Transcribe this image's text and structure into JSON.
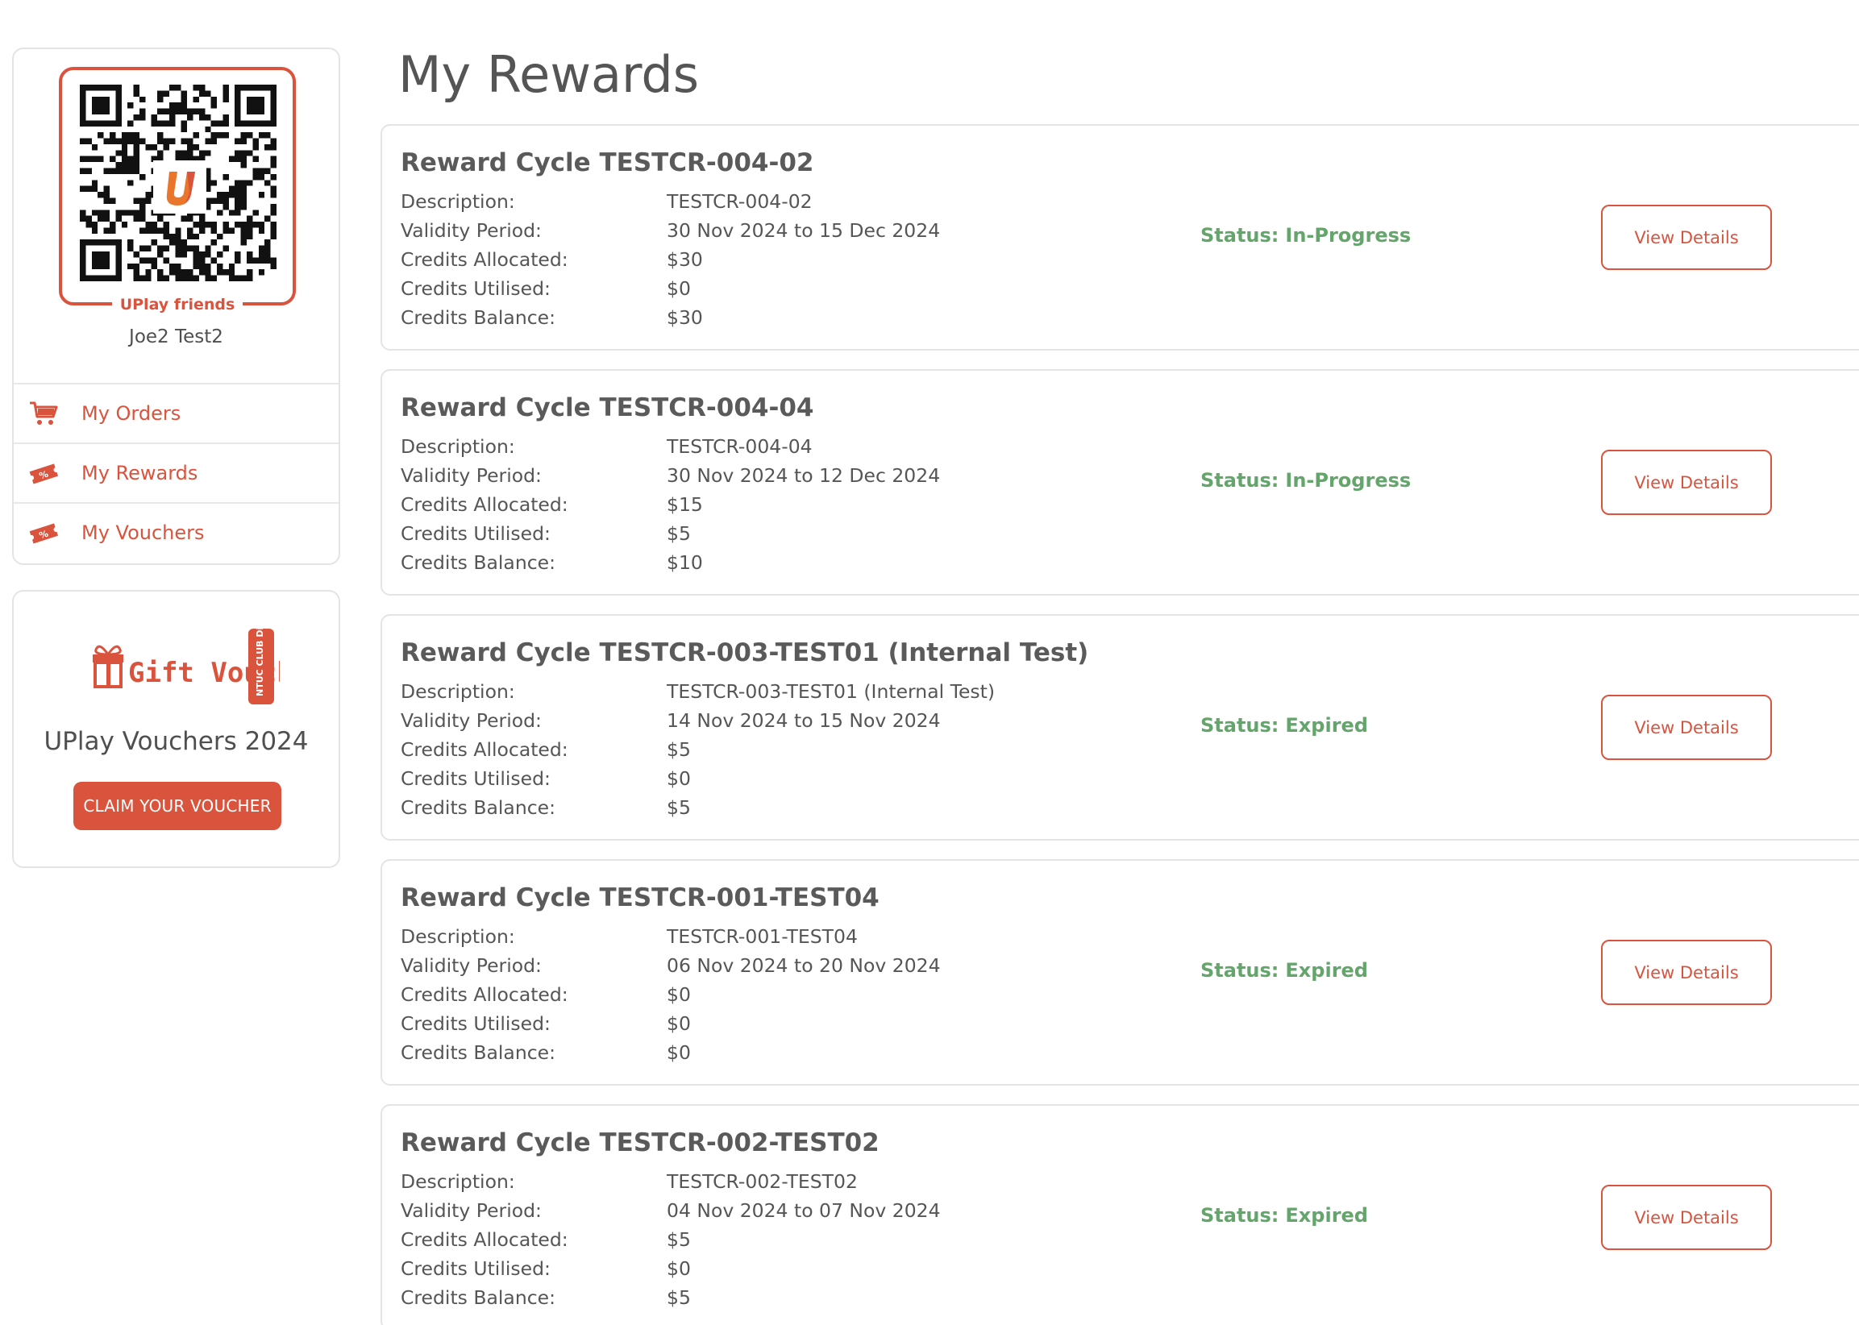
{
  "sidebar": {
    "qr_caption": "UPlay friends",
    "profile_name": "Joe2 Test2",
    "menu": [
      {
        "label": "My Orders",
        "icon": "shopping-cart-icon"
      },
      {
        "label": "My Rewards",
        "icon": "ticket-icon"
      },
      {
        "label": "My Vouchers",
        "icon": "ticket-icon"
      }
    ],
    "voucher": {
      "logo_text": "Gift Voucher",
      "logo_badge": "NTUC CLUB Discount",
      "title": "UPlay Vouchers 2024",
      "claim_label": "CLAIM YOUR VOUCHER"
    }
  },
  "main": {
    "title": "My Rewards",
    "field_labels": {
      "description": "Description:",
      "validity": "Validity Period:",
      "allocated": "Credits Allocated:",
      "utilised": "Credits Utilised:",
      "balance": "Credits Balance:"
    },
    "status_prefix": "Status:",
    "view_details_label": "View Details",
    "rewards": [
      {
        "title": "Reward Cycle TESTCR-004-02",
        "description": "TESTCR-004-02",
        "validity": "30 Nov 2024 to 15 Dec 2024",
        "allocated": "$30",
        "utilised": "$0",
        "balance": "$30",
        "status": "In-Progress"
      },
      {
        "title": "Reward Cycle TESTCR-004-04",
        "description": "TESTCR-004-04",
        "validity": "30 Nov 2024 to 12 Dec 2024",
        "allocated": "$15",
        "utilised": "$5",
        "balance": "$10",
        "status": "In-Progress"
      },
      {
        "title": "Reward Cycle TESTCR-003-TEST01 (Internal Test)",
        "description": "TESTCR-003-TEST01 (Internal Test)",
        "validity": "14 Nov 2024 to 15 Nov 2024",
        "allocated": "$5",
        "utilised": "$0",
        "balance": "$5",
        "status": "Expired"
      },
      {
        "title": "Reward Cycle TESTCR-001-TEST04",
        "description": "TESTCR-001-TEST04",
        "validity": "06 Nov 2024 to 20 Nov 2024",
        "allocated": "$0",
        "utilised": "$0",
        "balance": "$0",
        "status": "Expired"
      },
      {
        "title": "Reward Cycle TESTCR-002-TEST02",
        "description": "TESTCR-002-TEST02",
        "validity": "04 Nov 2024 to 07 Nov 2024",
        "allocated": "$5",
        "utilised": "$0",
        "balance": "$5",
        "status": "Expired"
      }
    ]
  },
  "colors": {
    "accent": "#d9533d",
    "status_green": "#63a56b",
    "text": "#555555",
    "border": "#e4e4e4"
  }
}
